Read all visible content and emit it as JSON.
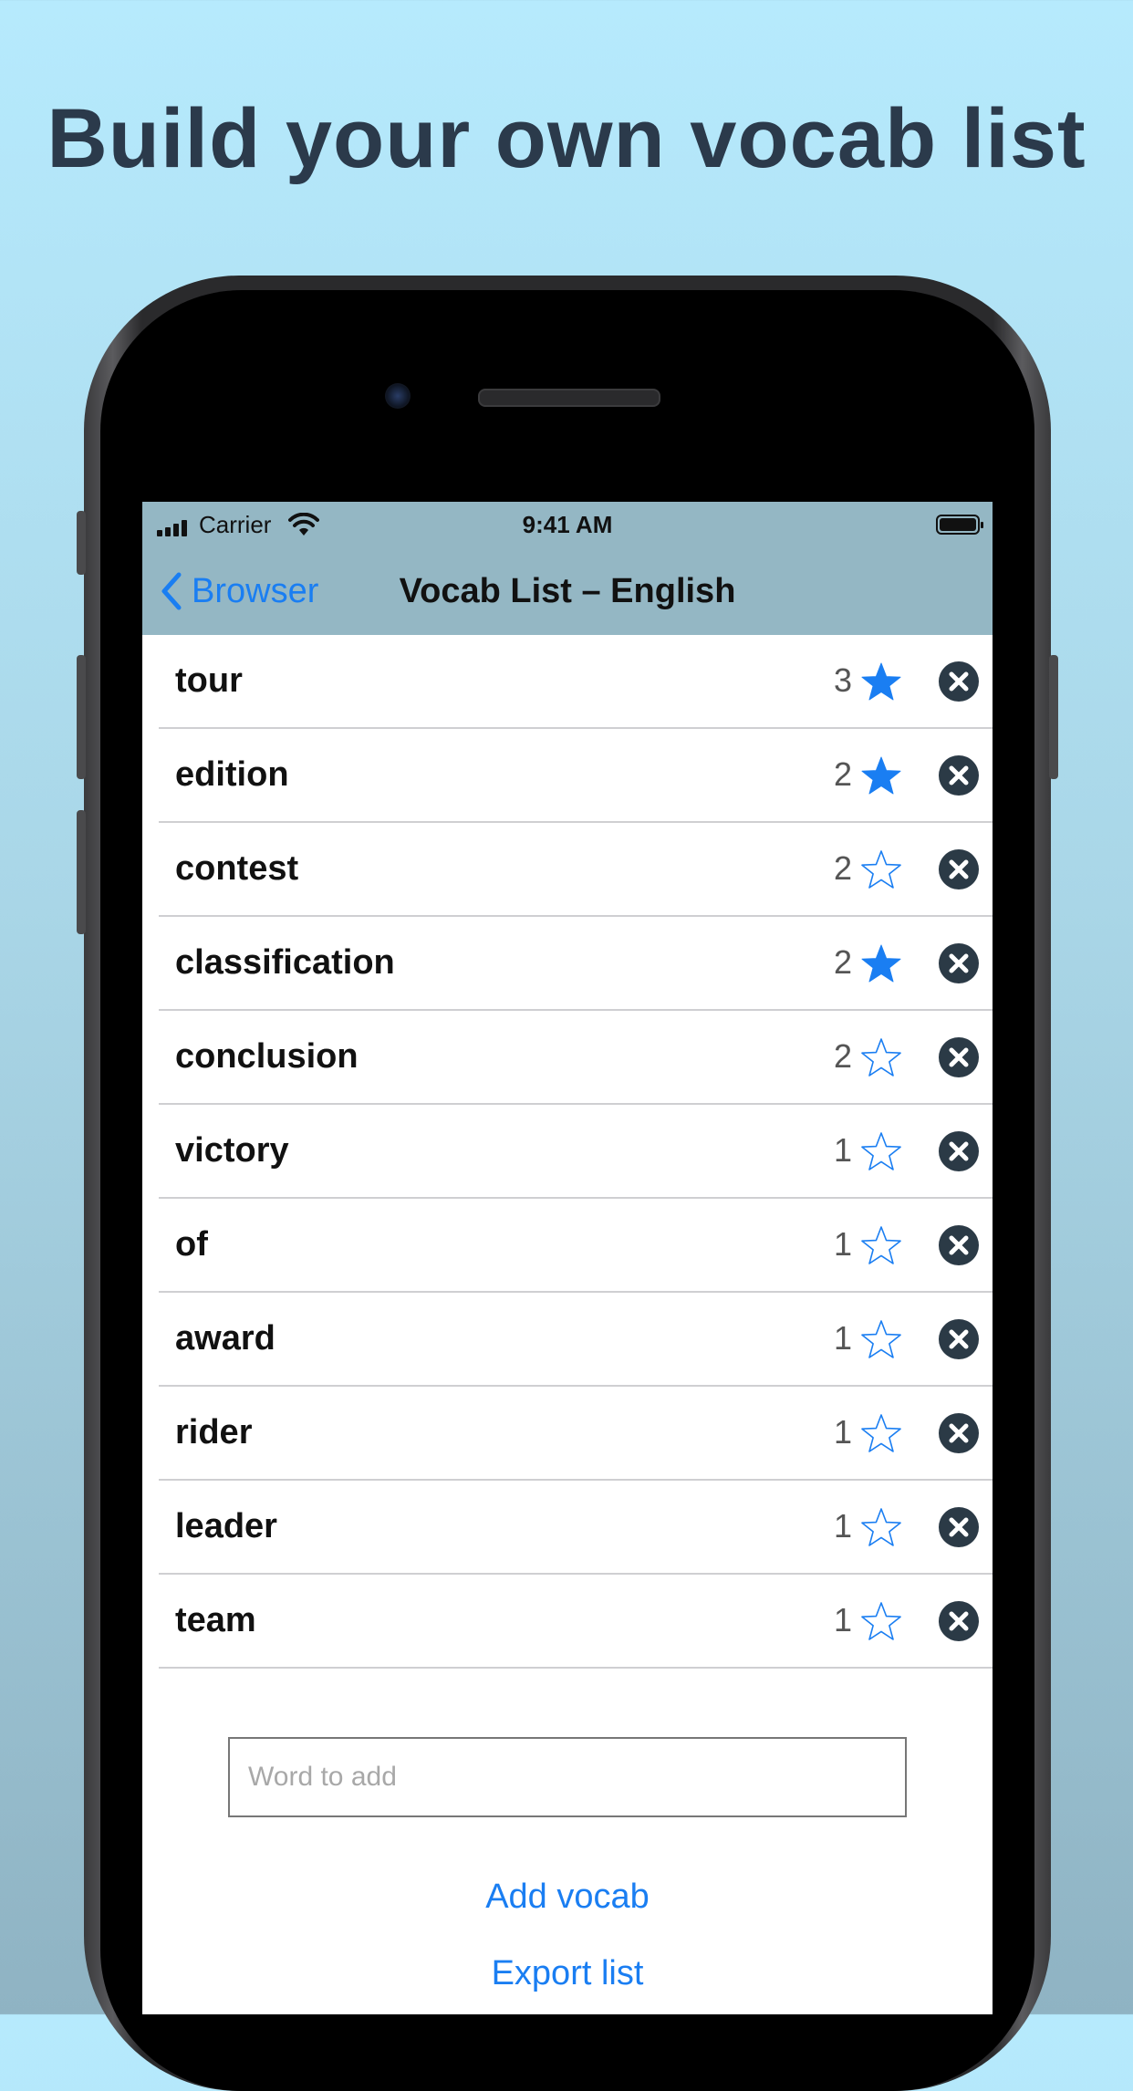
{
  "headline": "Build your own vocab list",
  "status_bar": {
    "carrier": "Carrier",
    "time": "9:41 AM"
  },
  "nav": {
    "back_label": "Browser",
    "title": "Vocab List – English"
  },
  "colors": {
    "accent": "#1a7ef2",
    "remove": "#2b3a46",
    "navbar": "#94b7c4"
  },
  "vocab_rows": [
    {
      "word": "tour",
      "count": "3",
      "starred": true
    },
    {
      "word": "edition",
      "count": "2",
      "starred": true
    },
    {
      "word": "contest",
      "count": "2",
      "starred": false
    },
    {
      "word": "classification",
      "count": "2",
      "starred": true
    },
    {
      "word": "conclusion",
      "count": "2",
      "starred": false
    },
    {
      "word": "victory",
      "count": "1",
      "starred": false
    },
    {
      "word": "of",
      "count": "1",
      "starred": false
    },
    {
      "word": "award",
      "count": "1",
      "starred": false
    },
    {
      "word": "rider",
      "count": "1",
      "starred": false
    },
    {
      "word": "leader",
      "count": "1",
      "starred": false
    },
    {
      "word": "team",
      "count": "1",
      "starred": false
    }
  ],
  "add_form": {
    "placeholder": "Word to add",
    "value": "",
    "add_label": "Add vocab",
    "export_label": "Export list"
  }
}
